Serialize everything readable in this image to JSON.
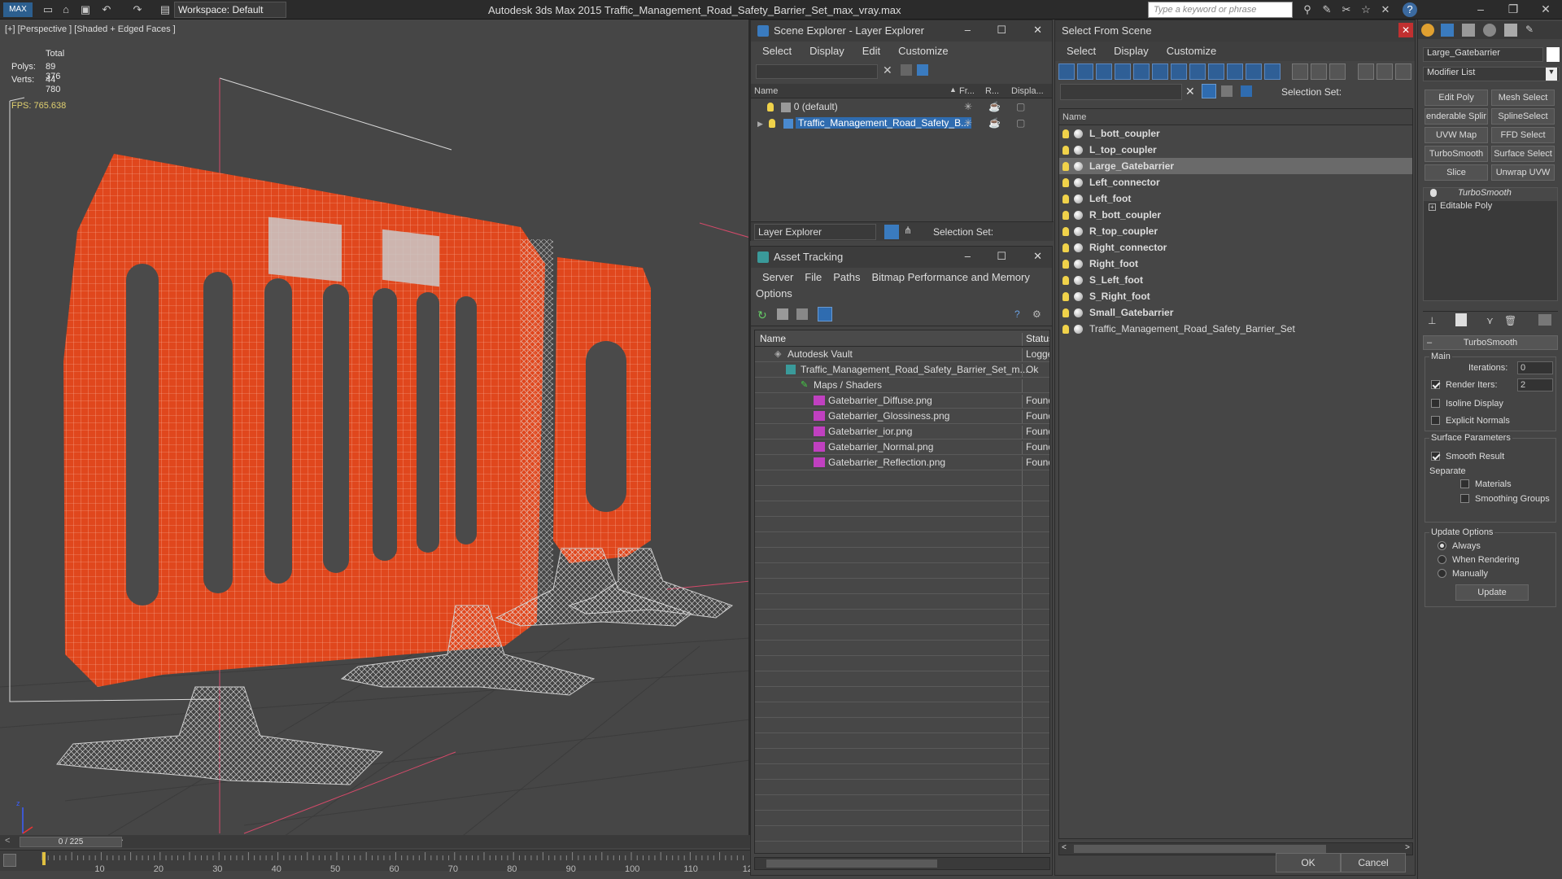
{
  "titlebar": {
    "workspace": "Workspace: Default",
    "app_title": "Autodesk 3ds Max  2015      Traffic_Management_Road_Safety_Barrier_Set_max_vray.max",
    "search_placeholder": "Type a keyword or phrase"
  },
  "viewport": {
    "label": "[+] [Perspective ] [Shaded + Edged Faces ]",
    "stats": {
      "total_label": "Total",
      "polys_label": "Polys:",
      "polys": "89 376",
      "verts_label": "Verts:",
      "verts": "44 780"
    },
    "fps": "FPS:     765.638",
    "time_slider": "0 / 225",
    "ticks": [
      "10",
      "20",
      "30",
      "40",
      "50",
      "60",
      "70",
      "80",
      "90",
      "100",
      "110",
      "12"
    ]
  },
  "scene_explorer": {
    "title": "Scene Explorer - Layer Explorer",
    "menu": [
      "Select",
      "Display",
      "Edit",
      "Customize"
    ],
    "columns": {
      "name": "Name",
      "frozen": "Fr...",
      "render": "R...",
      "display": "Displa..."
    },
    "rows": [
      {
        "name": "0 (default)"
      },
      {
        "name": "Traffic_Management_Road_Safety_B..."
      }
    ],
    "footer_dropdown": "Layer Explorer",
    "selection_set": "Selection Set:"
  },
  "asset_tracking": {
    "title": "Asset Tracking",
    "menu": [
      "Server",
      "File",
      "Paths",
      "Bitmap Performance and Memory"
    ],
    "menu2": "Options",
    "columns": {
      "name": "Name",
      "status": "Status"
    },
    "rows": [
      {
        "name": "Autodesk Vault",
        "status": "Logge"
      },
      {
        "name": "Traffic_Management_Road_Safety_Barrier_Set_m...",
        "status": "Ok"
      },
      {
        "name": "Maps / Shaders",
        "status": ""
      },
      {
        "name": "Gatebarrier_Diffuse.png",
        "status": "Found"
      },
      {
        "name": "Gatebarrier_Glossiness.png",
        "status": "Found"
      },
      {
        "name": "Gatebarrier_ior.png",
        "status": "Found"
      },
      {
        "name": "Gatebarrier_Normal.png",
        "status": "Found"
      },
      {
        "name": "Gatebarrier_Reflection.png",
        "status": "Found"
      }
    ]
  },
  "select_from_scene": {
    "title": "Select From Scene",
    "menu": [
      "Select",
      "Display",
      "Customize"
    ],
    "selection_set": "Selection Set:",
    "column_name": "Name",
    "items": [
      "L_bott_coupler",
      "L_top_coupler",
      "Large_Gatebarrier",
      "Left_connector",
      "Left_foot",
      "R_bott_coupler",
      "R_top_coupler",
      "Right_connector",
      "Right_foot",
      "S_Left_foot",
      "S_Right_foot",
      "Small_Gatebarrier",
      "Traffic_Management_Road_Safety_Barrier_Set"
    ],
    "selected": "Large_Gatebarrier",
    "ok": "OK",
    "cancel": "Cancel"
  },
  "command_panel": {
    "object_name": "Large_Gatebarrier",
    "modifier_list": "Modifier List",
    "buttons": [
      "Edit Poly",
      "Mesh Select",
      "enderable Splir",
      "SplineSelect",
      "UVW Map",
      "FFD Select",
      "TurboSmooth",
      "Surface Select",
      "Slice",
      "Unwrap UVW"
    ],
    "stack": [
      "TurboSmooth",
      "Editable Poly"
    ],
    "rollout_title": "TurboSmooth",
    "main": "Main",
    "iterations_label": "Iterations:",
    "iterations": "0",
    "render_iters_label": "Render Iters:",
    "render_iters": "2",
    "isoline": "Isoline Display",
    "explicit_normals": "Explicit Normals",
    "surface_params": "Surface Parameters",
    "smooth_result": "Smooth Result",
    "separate": "Separate",
    "materials": "Materials",
    "smoothing_groups": "Smoothing Groups",
    "update_options": "Update Options",
    "always": "Always",
    "when_rendering": "When Rendering",
    "manually": "Manually",
    "update": "Update"
  }
}
